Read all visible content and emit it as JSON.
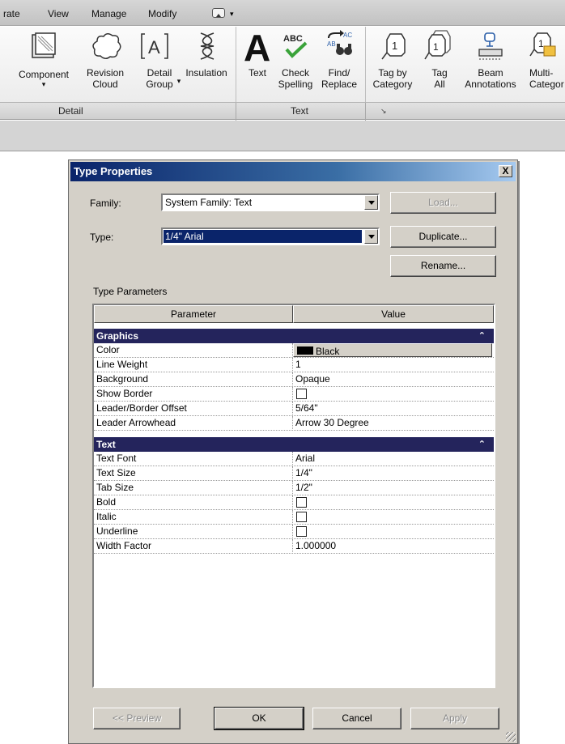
{
  "menu": {
    "items": [
      "rate",
      "View",
      "Manage",
      "Modify"
    ],
    "quick_access_arrow": "▾"
  },
  "ribbon": {
    "tools": [
      {
        "name": "component",
        "label": "Component",
        "icon": "component-icon",
        "has_dropdown": true
      },
      {
        "name": "revision-cloud",
        "label": "Revision\nCloud",
        "icon": "revision-cloud-icon"
      },
      {
        "name": "detail-group",
        "label": "Detail\nGroup",
        "icon": "detail-group-icon",
        "has_dropdown": true
      },
      {
        "name": "insulation",
        "label": "Insulation",
        "icon": "insulation-icon"
      },
      {
        "name": "text",
        "label": "Text",
        "icon": "text-a-icon"
      },
      {
        "name": "check-spelling",
        "label": "Check\nSpelling",
        "icon": "spellcheck-icon"
      },
      {
        "name": "find-replace",
        "label": "Find/\nReplace",
        "icon": "find-replace-icon"
      },
      {
        "name": "tag-by-category",
        "label": "Tag by\nCategory",
        "icon": "tag-icon"
      },
      {
        "name": "tag-all",
        "label": "Tag\nAll",
        "icon": "tag-all-icon"
      },
      {
        "name": "beam-annotations",
        "label": "Beam\nAnnotations",
        "icon": "beam-annotation-icon"
      },
      {
        "name": "multi-category",
        "label": "Multi-\nCategor",
        "icon": "multi-category-tag-icon"
      }
    ],
    "panels": {
      "detail": "Detail",
      "text": "Text"
    },
    "launcher": "↘"
  },
  "dialog": {
    "title": "Type Properties",
    "close": "X",
    "family_label": "Family:",
    "family_value": "System Family: Text",
    "type_label": "Type:",
    "type_value": "1/4\" Arial",
    "buttons": {
      "load": "Load...",
      "duplicate": "Duplicate...",
      "rename": "Rename..."
    },
    "type_parameters_label": "Type Parameters",
    "headers": {
      "parameter": "Parameter",
      "value": "Value"
    },
    "groups": [
      {
        "name": "Graphics",
        "collapse_glyph": "⌃",
        "rows": [
          {
            "param": "Color",
            "value": "Black",
            "kind": "color",
            "swatch": "#000000"
          },
          {
            "param": "Line Weight",
            "value": "1",
            "kind": "text"
          },
          {
            "param": "Background",
            "value": "Opaque",
            "kind": "text"
          },
          {
            "param": "Show Border",
            "value": "",
            "kind": "checkbox",
            "checked": false
          },
          {
            "param": "Leader/Border Offset",
            "value": "5/64\"",
            "kind": "text"
          },
          {
            "param": "Leader Arrowhead",
            "value": "Arrow 30 Degree",
            "kind": "text"
          }
        ]
      },
      {
        "name": "Text",
        "collapse_glyph": "⌃",
        "rows": [
          {
            "param": "Text Font",
            "value": "Arial",
            "kind": "text"
          },
          {
            "param": "Text Size",
            "value": "1/4\"",
            "kind": "text"
          },
          {
            "param": "Tab Size",
            "value": "1/2\"",
            "kind": "text"
          },
          {
            "param": "Bold",
            "value": "",
            "kind": "checkbox",
            "checked": false
          },
          {
            "param": "Italic",
            "value": "",
            "kind": "checkbox",
            "checked": false
          },
          {
            "param": "Underline",
            "value": "",
            "kind": "checkbox",
            "checked": false
          },
          {
            "param": "Width Factor",
            "value": "1.000000",
            "kind": "text"
          }
        ]
      }
    ],
    "footer": {
      "preview": "<< Preview",
      "ok": "OK",
      "cancel": "Cancel",
      "apply": "Apply"
    }
  },
  "colors": {
    "title_start": "#0a246a",
    "group_header": "#24245c",
    "dialog_face": "#d4d0c8"
  }
}
